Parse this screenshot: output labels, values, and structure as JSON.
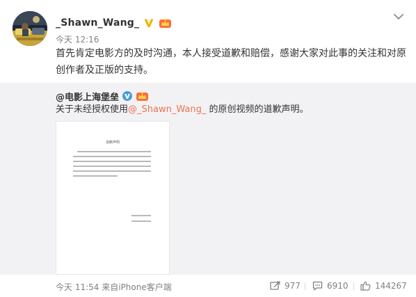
{
  "post": {
    "username": "_Shawn_Wang_",
    "timestamp": "今天 12:16",
    "content": "首先肯定电影方的及时沟通，本人接受道歉和赔偿，感谢大家对此事的关注和对原创作者及正版的支持。"
  },
  "repost": {
    "username": "@电影上海堡垒",
    "text_prefix": "关于未经授权使用",
    "mention": "@_Shawn_Wang_",
    "text_suffix": " 的原创视频的道歉声明。",
    "image": {
      "title": "道歉声明"
    }
  },
  "footer": {
    "time_source": "今天 11:54 来自iPhone客户端",
    "reposts": "977",
    "comments": "6910",
    "likes": "144267"
  },
  "colors": {
    "mention": "#eb7350",
    "verified_badge": "#f0b400",
    "repost_background": "#f2f2f5"
  },
  "icons": {
    "verified": "verified-v-icon",
    "member": "member-crown-icon",
    "expand": "chevron-down-icon",
    "repost": "repost-icon",
    "comment": "comment-icon",
    "like": "thumbs-up-icon"
  }
}
